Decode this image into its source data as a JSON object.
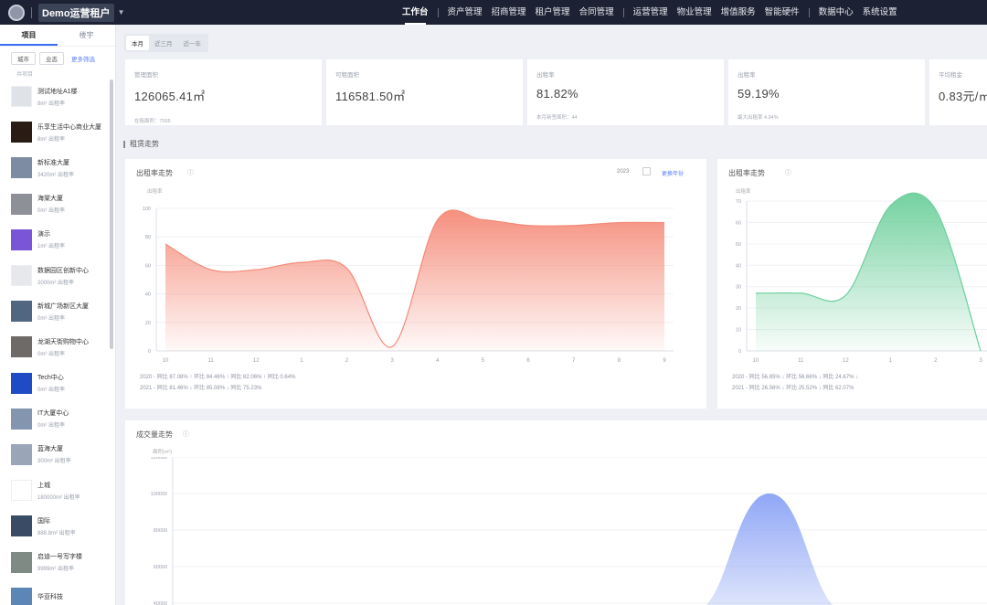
{
  "app": {
    "brand": "Demo运营租户",
    "nav": [
      "工作台",
      "资产管理",
      "招商管理",
      "租户管理",
      "合同管理",
      "运营管理",
      "物业管理",
      "增值服务",
      "智能硬件",
      "数据中心",
      "系统设置"
    ],
    "active_nav": "工作台"
  },
  "sidebar": {
    "tabs": [
      "项目",
      "楼宇"
    ],
    "filters": [
      "城市",
      "业态"
    ],
    "filter_link": "更多筛选",
    "count_label": "共项目",
    "items": [
      {
        "name": "测试地址A1楼",
        "sub": "8m²  出租率",
        "thumb": "#dfe2e7"
      },
      {
        "name": "乐享生活中心商业大厦",
        "sub": "8m²  出租率",
        "thumb": "#2a1b15"
      },
      {
        "name": "新标准大厦",
        "sub": "3420m²  出租率",
        "thumb": "#7d8ba3"
      },
      {
        "name": "海棠大厦",
        "sub": "0m²  出租率",
        "thumb": "#8e9098"
      },
      {
        "name": "演示",
        "sub": "1m²  出租率",
        "thumb": "#7a55d8"
      },
      {
        "name": "数据园区创新中心",
        "sub": "2000m²  出租率",
        "thumb": "#e6e8ec"
      },
      {
        "name": "新城广场新区大厦",
        "sub": "0m²  出租率",
        "thumb": "#516680"
      },
      {
        "name": "龙湖天街购物中心",
        "sub": "0m²  出租率",
        "thumb": "#6e6a67"
      },
      {
        "name": "Tech中心",
        "sub": "0m²  出租率",
        "thumb": "#1f4cc4"
      },
      {
        "name": "IT大厦中心",
        "sub": "0m²  出租率",
        "thumb": "#8495b0"
      },
      {
        "name": "蓝海大厦",
        "sub": "300m²  出租率",
        "thumb": "#9aa6b8"
      },
      {
        "name": "上城",
        "sub": "180000m²  出租率",
        "thumb": "#ffffff"
      },
      {
        "name": "国际",
        "sub": "888.8m²  出租率",
        "thumb": "#394c66"
      },
      {
        "name": "启迪一号写字楼",
        "sub": "9999m²  出租率",
        "thumb": "#7f8a84"
      },
      {
        "name": "华亚科技",
        "sub": "",
        "thumb": "#5c86b6"
      }
    ]
  },
  "page_tabs": [
    "本月",
    "近三月",
    "近一年"
  ],
  "kpis": [
    {
      "label": "管理面积",
      "value": "126065.41㎡",
      "foot": "在租面积：7565"
    },
    {
      "label": "可租面积",
      "value": "116581.50㎡",
      "foot": ""
    },
    {
      "label": "出租率",
      "value": "81.82%",
      "foot": "本月新签面积：44"
    },
    {
      "label": "出租率",
      "value": "59.19%",
      "foot": "最大出租率 4.94%"
    },
    {
      "label": "平均租金",
      "value": "0.83元/㎡",
      "foot": ""
    }
  ],
  "section_title": "租赁走势",
  "charts": {
    "left": {
      "title": "出租率走势",
      "select_label": "2023",
      "link_label": "更换年份",
      "ylabel": "出租率",
      "legend": [
        "2020 - 同比  87.08% ↑  环比  84.46% ↑  同比  82.06% ↑  同比  0.64%",
        "2021 - 同比  81.46% ↓  环比  85.08% ↓  同比  75.23%"
      ],
      "color": "#f58a78"
    },
    "right": {
      "title": "出租率走势",
      "ylabel": "出租率",
      "legend": [
        "2020 - 同比  56.65% ↓  环比  56.66% ↓  同比  24.67% ↓",
        "2021 - 同比  26.56% ↓  环比  25.52% ↓  同比  62.07%"
      ],
      "color": "#6dcf9b"
    },
    "bottom": {
      "title": "成交量走势",
      "ylabel": "面积(m²)",
      "color": "#8aa2f5"
    }
  },
  "chart_data": [
    {
      "type": "area",
      "title": "出租率走势",
      "x": [
        "10",
        "11",
        "12",
        "1",
        "2",
        "3",
        "4",
        "5",
        "6",
        "7",
        "8",
        "9"
      ],
      "series": [
        {
          "values": [
            75,
            57,
            57,
            62,
            58,
            3,
            92,
            92,
            88,
            88,
            90,
            90
          ]
        }
      ],
      "ylim": [
        0,
        100
      ],
      "yticks": [
        0,
        20,
        40,
        60,
        80,
        100
      ]
    },
    {
      "type": "area",
      "title": "出租率走势",
      "x": [
        "10",
        "11",
        "12",
        "1",
        "2",
        "3"
      ],
      "series": [
        {
          "values": [
            27,
            27,
            26,
            68,
            66,
            0
          ]
        }
      ],
      "ylim": [
        0,
        70
      ],
      "yticks": [
        0,
        10,
        20,
        30,
        40,
        50,
        60,
        70
      ]
    },
    {
      "type": "area",
      "title": "成交量走势",
      "yticks": [
        0,
        20000,
        40000,
        60000,
        80000,
        100000,
        120000
      ],
      "ylim": [
        0,
        120000
      ]
    }
  ]
}
